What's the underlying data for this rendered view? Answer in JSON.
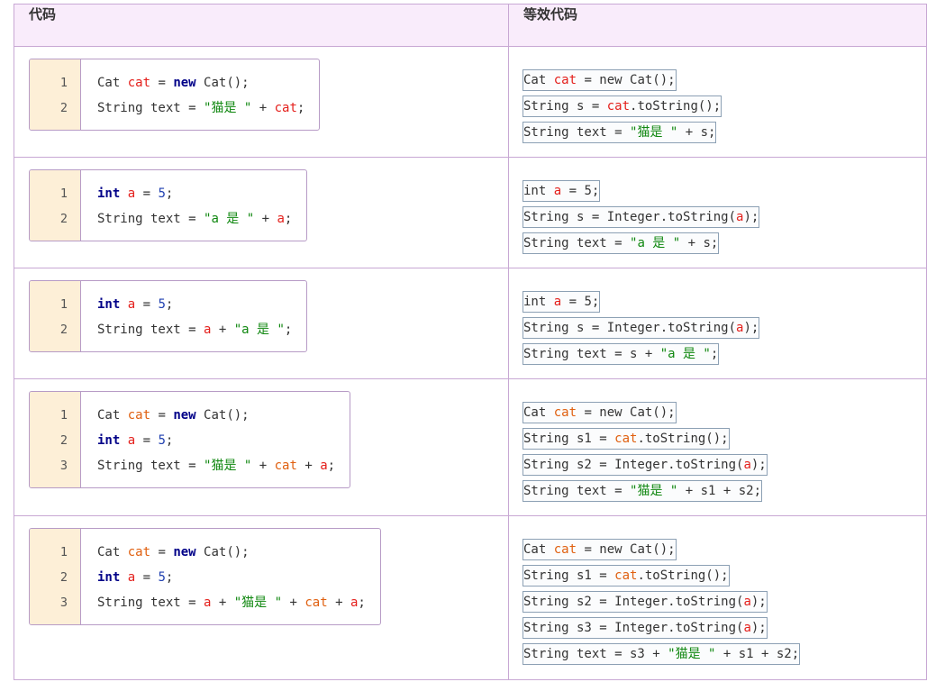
{
  "table": {
    "headers": [
      "代码",
      "等效代码"
    ],
    "rows": [
      {
        "code": [
          [
            [
              "Cat ",
              "plain"
            ],
            [
              "cat",
              "var"
            ],
            [
              " = ",
              "plain"
            ],
            [
              "new",
              "kw"
            ],
            [
              " Cat();",
              "plain"
            ]
          ],
          [
            [
              "String text = ",
              "plain"
            ],
            [
              "\"猫是 \"",
              "str"
            ],
            [
              " + ",
              "plain"
            ],
            [
              "cat",
              "var"
            ],
            [
              ";",
              "plain"
            ]
          ]
        ],
        "equivalent": [
          [
            [
              "Cat ",
              "plain"
            ],
            [
              "cat",
              "var"
            ],
            [
              " = new Cat();",
              "plain"
            ]
          ],
          [
            [
              "String s = ",
              "plain"
            ],
            [
              "cat",
              "var"
            ],
            [
              ".toString();",
              "plain"
            ]
          ],
          [
            [
              "String text = ",
              "plain"
            ],
            [
              "\"猫是 \"",
              "str"
            ],
            [
              " + s;",
              "plain"
            ]
          ]
        ]
      },
      {
        "code": [
          [
            [
              "int",
              "kw"
            ],
            [
              " ",
              "plain"
            ],
            [
              "a",
              "var"
            ],
            [
              " = ",
              "plain"
            ],
            [
              "5",
              "num"
            ],
            [
              ";",
              "plain"
            ]
          ],
          [
            [
              "String text = ",
              "plain"
            ],
            [
              "\"a 是 \"",
              "str"
            ],
            [
              " + ",
              "plain"
            ],
            [
              "a",
              "var"
            ],
            [
              ";",
              "plain"
            ]
          ]
        ],
        "equivalent": [
          [
            [
              "int ",
              "plain"
            ],
            [
              "a",
              "var"
            ],
            [
              " = 5;",
              "plain"
            ]
          ],
          [
            [
              "String s = Integer.toString(",
              "plain"
            ],
            [
              "a",
              "var"
            ],
            [
              ");",
              "plain"
            ]
          ],
          [
            [
              "String text = ",
              "plain"
            ],
            [
              "\"a 是 \"",
              "str"
            ],
            [
              " + s;",
              "plain"
            ]
          ]
        ]
      },
      {
        "code": [
          [
            [
              "int",
              "kw"
            ],
            [
              " ",
              "plain"
            ],
            [
              "a",
              "var"
            ],
            [
              " = ",
              "plain"
            ],
            [
              "5",
              "num"
            ],
            [
              ";",
              "plain"
            ]
          ],
          [
            [
              "String text = ",
              "plain"
            ],
            [
              "a",
              "var"
            ],
            [
              " + ",
              "plain"
            ],
            [
              "\"a 是 \"",
              "str"
            ],
            [
              ";",
              "plain"
            ]
          ]
        ],
        "equivalent": [
          [
            [
              "int ",
              "plain"
            ],
            [
              "a",
              "var"
            ],
            [
              " = 5;",
              "plain"
            ]
          ],
          [
            [
              "String s = Integer.toString(",
              "plain"
            ],
            [
              "a",
              "var"
            ],
            [
              ");",
              "plain"
            ]
          ],
          [
            [
              "String text = s + ",
              "plain"
            ],
            [
              "\"a 是 \"",
              "str"
            ],
            [
              ";",
              "plain"
            ]
          ]
        ]
      },
      {
        "code": [
          [
            [
              "Cat ",
              "plain"
            ],
            [
              "cat",
              "obj"
            ],
            [
              " = ",
              "plain"
            ],
            [
              "new",
              "kw"
            ],
            [
              " Cat();",
              "plain"
            ]
          ],
          [
            [
              "int",
              "kw"
            ],
            [
              " ",
              "plain"
            ],
            [
              "a",
              "var"
            ],
            [
              " = ",
              "plain"
            ],
            [
              "5",
              "num"
            ],
            [
              ";",
              "plain"
            ]
          ],
          [
            [
              "String text = ",
              "plain"
            ],
            [
              "\"猫是 \"",
              "str"
            ],
            [
              " + ",
              "plain"
            ],
            [
              "cat",
              "obj"
            ],
            [
              " + ",
              "plain"
            ],
            [
              "a",
              "var"
            ],
            [
              ";",
              "plain"
            ]
          ]
        ],
        "equivalent": [
          [
            [
              "Cat ",
              "plain"
            ],
            [
              "cat",
              "obj"
            ],
            [
              " = new Cat();",
              "plain"
            ]
          ],
          [
            [
              "String s1 = ",
              "plain"
            ],
            [
              "cat",
              "obj"
            ],
            [
              ".toString();",
              "plain"
            ]
          ],
          [
            [
              "String s2 = Integer.toString(",
              "plain"
            ],
            [
              "a",
              "var"
            ],
            [
              ");",
              "plain"
            ]
          ],
          [
            [
              "String text = ",
              "plain"
            ],
            [
              "\"猫是 \"",
              "str"
            ],
            [
              " + s1 + s2;",
              "plain"
            ]
          ]
        ]
      },
      {
        "code": [
          [
            [
              "Cat ",
              "plain"
            ],
            [
              "cat",
              "obj"
            ],
            [
              " = ",
              "plain"
            ],
            [
              "new",
              "kw"
            ],
            [
              " Cat();",
              "plain"
            ]
          ],
          [
            [
              "int",
              "kw"
            ],
            [
              " ",
              "plain"
            ],
            [
              "a",
              "var"
            ],
            [
              " = ",
              "plain"
            ],
            [
              "5",
              "num"
            ],
            [
              ";",
              "plain"
            ]
          ],
          [
            [
              "String text = ",
              "plain"
            ],
            [
              "a",
              "var"
            ],
            [
              " + ",
              "plain"
            ],
            [
              "\"猫是 \"",
              "str"
            ],
            [
              " + ",
              "plain"
            ],
            [
              "cat",
              "obj"
            ],
            [
              " + ",
              "plain"
            ],
            [
              "a",
              "var"
            ],
            [
              ";",
              "plain"
            ]
          ]
        ],
        "equivalent": [
          [
            [
              "Cat ",
              "plain"
            ],
            [
              "cat",
              "obj"
            ],
            [
              " = new Cat();",
              "plain"
            ]
          ],
          [
            [
              "String s1 = ",
              "plain"
            ],
            [
              "cat",
              "obj"
            ],
            [
              ".toString();",
              "plain"
            ]
          ],
          [
            [
              "String s2 = Integer.toString(",
              "plain"
            ],
            [
              "a",
              "var"
            ],
            [
              ");",
              "plain"
            ]
          ],
          [
            [
              "String s3 = Integer.toString(",
              "plain"
            ],
            [
              "a",
              "var"
            ],
            [
              ");",
              "plain"
            ]
          ],
          [
            [
              "String text = s3 + ",
              "plain"
            ],
            [
              "\"猫是 \"",
              "str"
            ],
            [
              " + s1 + s2;",
              "plain"
            ]
          ]
        ]
      }
    ]
  }
}
